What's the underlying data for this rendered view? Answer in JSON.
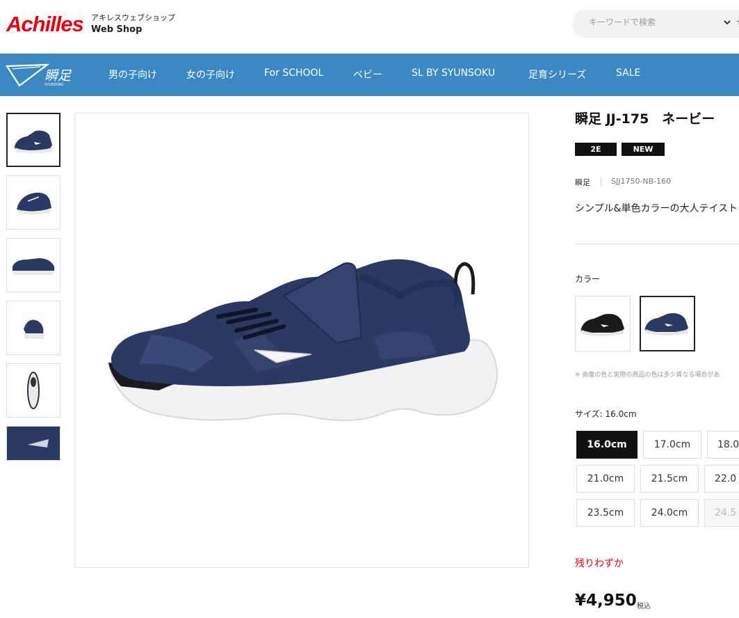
{
  "header": {
    "logo": "Achilles",
    "shop_sub": "アキレスウェブショップ",
    "shop_main": "Web Shop",
    "search_placeholder": "キーワードで検索",
    "search_trail": "す"
  },
  "nav": {
    "items": [
      "男の子向け",
      "女の子向け",
      "For SCHOOL",
      "ベビー",
      "SL BY SYUNSOKU",
      "足育シリーズ",
      "SALE"
    ]
  },
  "gallery": {
    "thumbnail_count": 6,
    "selected_index": 0
  },
  "product": {
    "title": "瞬足 JJ-175　ネービー",
    "badges": [
      "2E",
      "NEW"
    ],
    "brand": "瞬足",
    "sku": "SJJ1750-NB-160",
    "description": "シンプル&単色カラーの大人テイスト",
    "color_label": "カラー",
    "color_note": "※ 画像の色と実際の商品の色は多少異なる場合があ",
    "size_label": "サイズ: 16.0cm",
    "sizes": [
      "16.0cm",
      "17.0cm",
      "18.0",
      "21.0cm",
      "21.5cm",
      "22.0",
      "23.5cm",
      "24.0cm",
      "24.5"
    ],
    "selected_size": "16.0cm",
    "stock_status": "残りわずか",
    "price": "¥4,950",
    "tax_label": "税込"
  },
  "colors": {
    "nav_bg": "#3b88c3",
    "brand_red": "#e60012",
    "shoe_navy": "#2c3a63"
  }
}
